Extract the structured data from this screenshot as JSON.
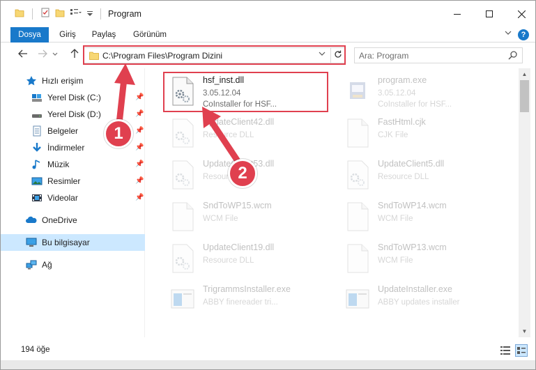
{
  "window": {
    "title": "Program"
  },
  "ribbon": {
    "tabs": [
      {
        "label": "Dosya"
      },
      {
        "label": "Giriş"
      },
      {
        "label": "Paylaş"
      },
      {
        "label": "Görünüm"
      }
    ],
    "help_label": "?"
  },
  "navigation": {
    "address_path": "C:\\Program Files\\Program Dizini",
    "search_placeholder": "Ara: Program"
  },
  "sidebar": {
    "items": [
      {
        "label": "Hızlı erişim",
        "icon": "star-icon",
        "pinned": false
      },
      {
        "label": "Yerel Disk (C:)",
        "icon": "drive-icon",
        "pinned": true
      },
      {
        "label": "Yerel Disk (D:)",
        "icon": "drive-icon",
        "pinned": true
      },
      {
        "label": "Belgeler",
        "icon": "documents-icon",
        "pinned": true
      },
      {
        "label": "İndirmeler",
        "icon": "download-icon",
        "pinned": true
      },
      {
        "label": "Müzik",
        "icon": "music-icon",
        "pinned": true
      },
      {
        "label": "Resimler",
        "icon": "pictures-icon",
        "pinned": true
      },
      {
        "label": "Videolar",
        "icon": "videos-icon",
        "pinned": true
      },
      {
        "label": "OneDrive",
        "icon": "cloud-icon",
        "pinned": false
      },
      {
        "label": "Bu bilgisayar",
        "icon": "computer-icon",
        "pinned": false,
        "selected": true
      },
      {
        "label": "Ağ",
        "icon": "network-icon",
        "pinned": false
      }
    ]
  },
  "files": [
    {
      "name": "hsf_inst.dll",
      "line2": "3.05.12.04",
      "line3": "CoInstaller for HSF...",
      "icon": "dll-gear-icon",
      "highlighted": true
    },
    {
      "name": "program.exe",
      "line2": "3.05.12.04",
      "line3": "CoInstaller for HSF...",
      "icon": "exe-installer-icon"
    },
    {
      "name": "UpdateClient42.dll",
      "line2": "Resource DLL",
      "line3": "",
      "icon": "dll-gear-icon"
    },
    {
      "name": "FastHtml.cjk",
      "line2": "CJK File",
      "line3": "",
      "icon": "blank-file-icon"
    },
    {
      "name": "UpdateClient53.dll",
      "line2": "Resource DLL",
      "line3": "",
      "icon": "dll-gear-icon"
    },
    {
      "name": "UpdateClient5.dll",
      "line2": "Resource DLL",
      "line3": "",
      "icon": "dll-gear-icon"
    },
    {
      "name": "SndToWP15.wcm",
      "line2": "WCM File",
      "line3": "",
      "icon": "blank-file-icon"
    },
    {
      "name": "SndToWP14.wcm",
      "line2": "WCM File",
      "line3": "",
      "icon": "blank-file-icon"
    },
    {
      "name": "UpdateClient19.dll",
      "line2": "Resource DLL",
      "line3": "",
      "icon": "dll-gear-icon"
    },
    {
      "name": "SndToWP13.wcm",
      "line2": "WCM File",
      "line3": "",
      "icon": "blank-file-icon"
    },
    {
      "name": "TrigrammsInstaller.exe",
      "line2": "ABBY finereader tri...",
      "line3": "",
      "icon": "window-app-icon"
    },
    {
      "name": "UpdateInstaller.exe",
      "line2": "ABBY updates installer",
      "line3": "",
      "icon": "window-app-icon"
    }
  ],
  "status": {
    "item_count": "194 öğe"
  },
  "annotations": {
    "badge1": "1",
    "badge2": "2"
  },
  "colors": {
    "accent": "#1979ca",
    "highlight_red": "#e0404f",
    "selected_bg": "#cce8ff"
  }
}
